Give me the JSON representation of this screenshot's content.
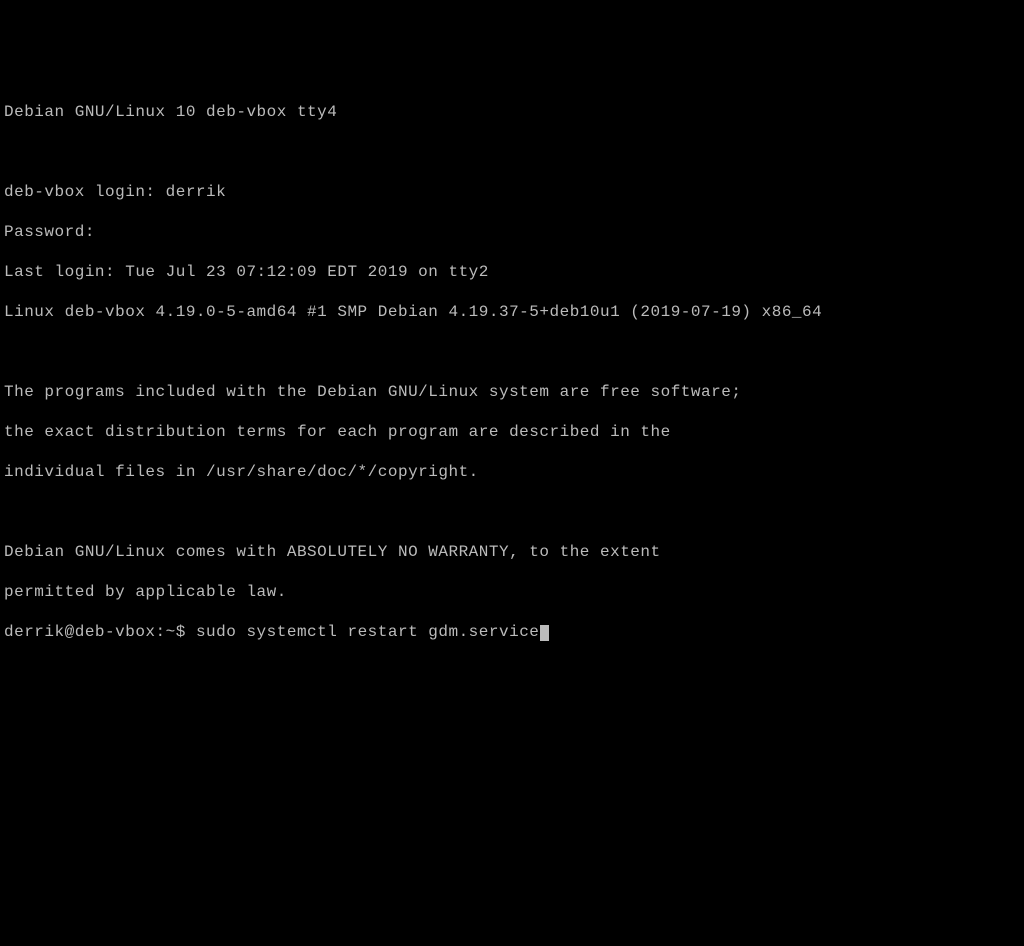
{
  "terminal": {
    "banner": "Debian GNU/Linux 10 deb-vbox tty4",
    "login_prompt_label": "deb-vbox login: ",
    "login_user": "derrik",
    "password_label": "Password:",
    "last_login": "Last login: Tue Jul 23 07:12:09 EDT 2019 on tty2",
    "kernel_info": "Linux deb-vbox 4.19.0-5-amd64 #1 SMP Debian 4.19.37-5+deb10u1 (2019-07-19) x86_64",
    "motd_line1": "The programs included with the Debian GNU/Linux system are free software;",
    "motd_line2": "the exact distribution terms for each program are described in the",
    "motd_line3": "individual files in /usr/share/doc/*/copyright.",
    "motd_line4": "Debian GNU/Linux comes with ABSOLUTELY NO WARRANTY, to the extent",
    "motd_line5": "permitted by applicable law.",
    "prompt": "derrik@deb-vbox:~$ ",
    "command": "sudo systemctl restart gdm.service"
  }
}
